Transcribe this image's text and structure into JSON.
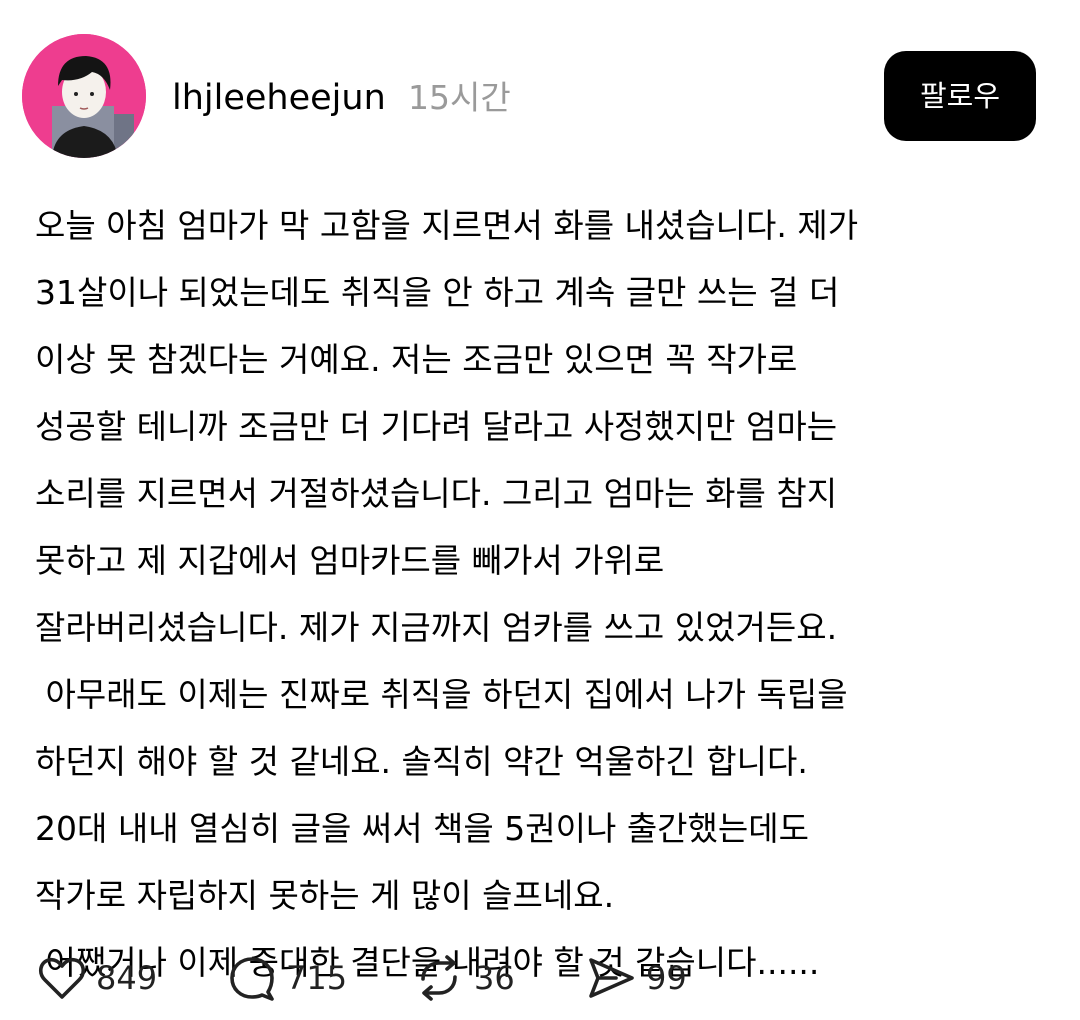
{
  "post": {
    "username": "lhjleeheejun",
    "time": "15시간",
    "follow_label": "팔로우",
    "lines": [
      "오늘 아침 엄마가 막 고함을 지르면서 화를 내셨습니다. 제가",
      "31살이나 되었는데도 취직을 안 하고 계속 글만 쓰는 걸 더",
      "이상 못 참겠다는 거예요. 저는 조금만 있으면 꼭 작가로",
      "성공할 테니까 조금만 더 기다려 달라고 사정했지만 엄마는",
      "소리를 지르면서 거절하셨습니다. 그리고 엄마는 화를 참지",
      "못하고 제 지갑에서 엄마카드를 빼가서 가위로",
      "잘라버리셨습니다. 제가 지금까지 엄카를 쓰고 있었거든요.",
      " 아무래도 이제는 진짜로 취직을 하던지 집에서 나가 독립을",
      "하던지 해야 할 것 같네요. 솔직히 약간 억울하긴 합니다.",
      "20대 내내 열심히 글을 써서 책을 5권이나 출간했는데도",
      "작가로 자립하지 못하는 게 많이 슬프네요.",
      " 어쨌거나 이제 중대한 결단을 내려야 할 것 같습니다......"
    ]
  },
  "actions": {
    "likes": "849",
    "comments": "715",
    "reposts": "36",
    "shares": "99"
  },
  "icons": {
    "like": "heart-icon",
    "comment": "speech-bubble-icon",
    "repost": "repost-arrows-icon",
    "share": "send-arrow-icon"
  },
  "colors": {
    "avatar_background": "#ee3d8f",
    "follow_button": "#000000",
    "time_text": "#9a9a9a"
  }
}
